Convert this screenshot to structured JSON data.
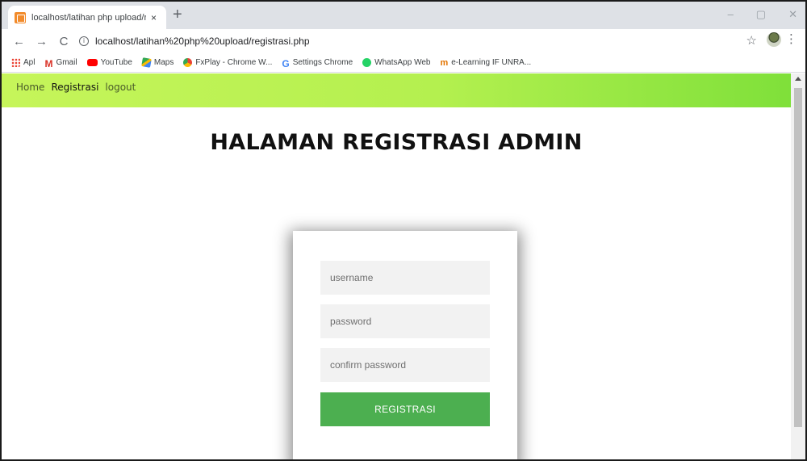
{
  "browser": {
    "tab": {
      "title": "localhost/latihan php upload/regi",
      "close": "×"
    },
    "new_tab": "+",
    "window_controls": {
      "minimize": "–",
      "maximize": "▢",
      "close": "✕"
    },
    "nav": {
      "back": "←",
      "forward": "→",
      "reload": "C"
    },
    "address_bar": {
      "info_glyph": "i",
      "url": "localhost/latihan%20php%20upload/registrasi.php"
    },
    "star": "☆",
    "menu": "⋮",
    "bookmarks": [
      {
        "label": "Apl",
        "icon": "apps-grid-icon"
      },
      {
        "label": "Gmail",
        "icon": "gmail-icon",
        "glyph": "M"
      },
      {
        "label": "YouTube",
        "icon": "youtube-icon"
      },
      {
        "label": "Maps",
        "icon": "maps-icon"
      },
      {
        "label": "FxPlay - Chrome W...",
        "icon": "chrome-icon"
      },
      {
        "label": "Settings Chrome",
        "icon": "google-icon",
        "glyph": "G"
      },
      {
        "label": "WhatsApp Web",
        "icon": "whatsapp-icon"
      },
      {
        "label": "e-Learning IF UNRA...",
        "icon": "elearning-icon",
        "glyph": "m"
      }
    ]
  },
  "site_nav": {
    "items": [
      {
        "label": "Home",
        "active": false
      },
      {
        "label": "Registrasi",
        "active": true
      },
      {
        "label": "logout",
        "active": false
      }
    ]
  },
  "page": {
    "title": "HALAMAN REGISTRASI ADMIN",
    "form": {
      "username_placeholder": "username",
      "password_placeholder": "password",
      "confirm_placeholder": "confirm password",
      "submit_label": "REGISTRASI"
    }
  },
  "colors": {
    "nav_gradient_start": "#c6f55a",
    "nav_gradient_end": "#7fe03a",
    "submit_button": "#4caf50",
    "field_background": "#f2f2f2"
  }
}
